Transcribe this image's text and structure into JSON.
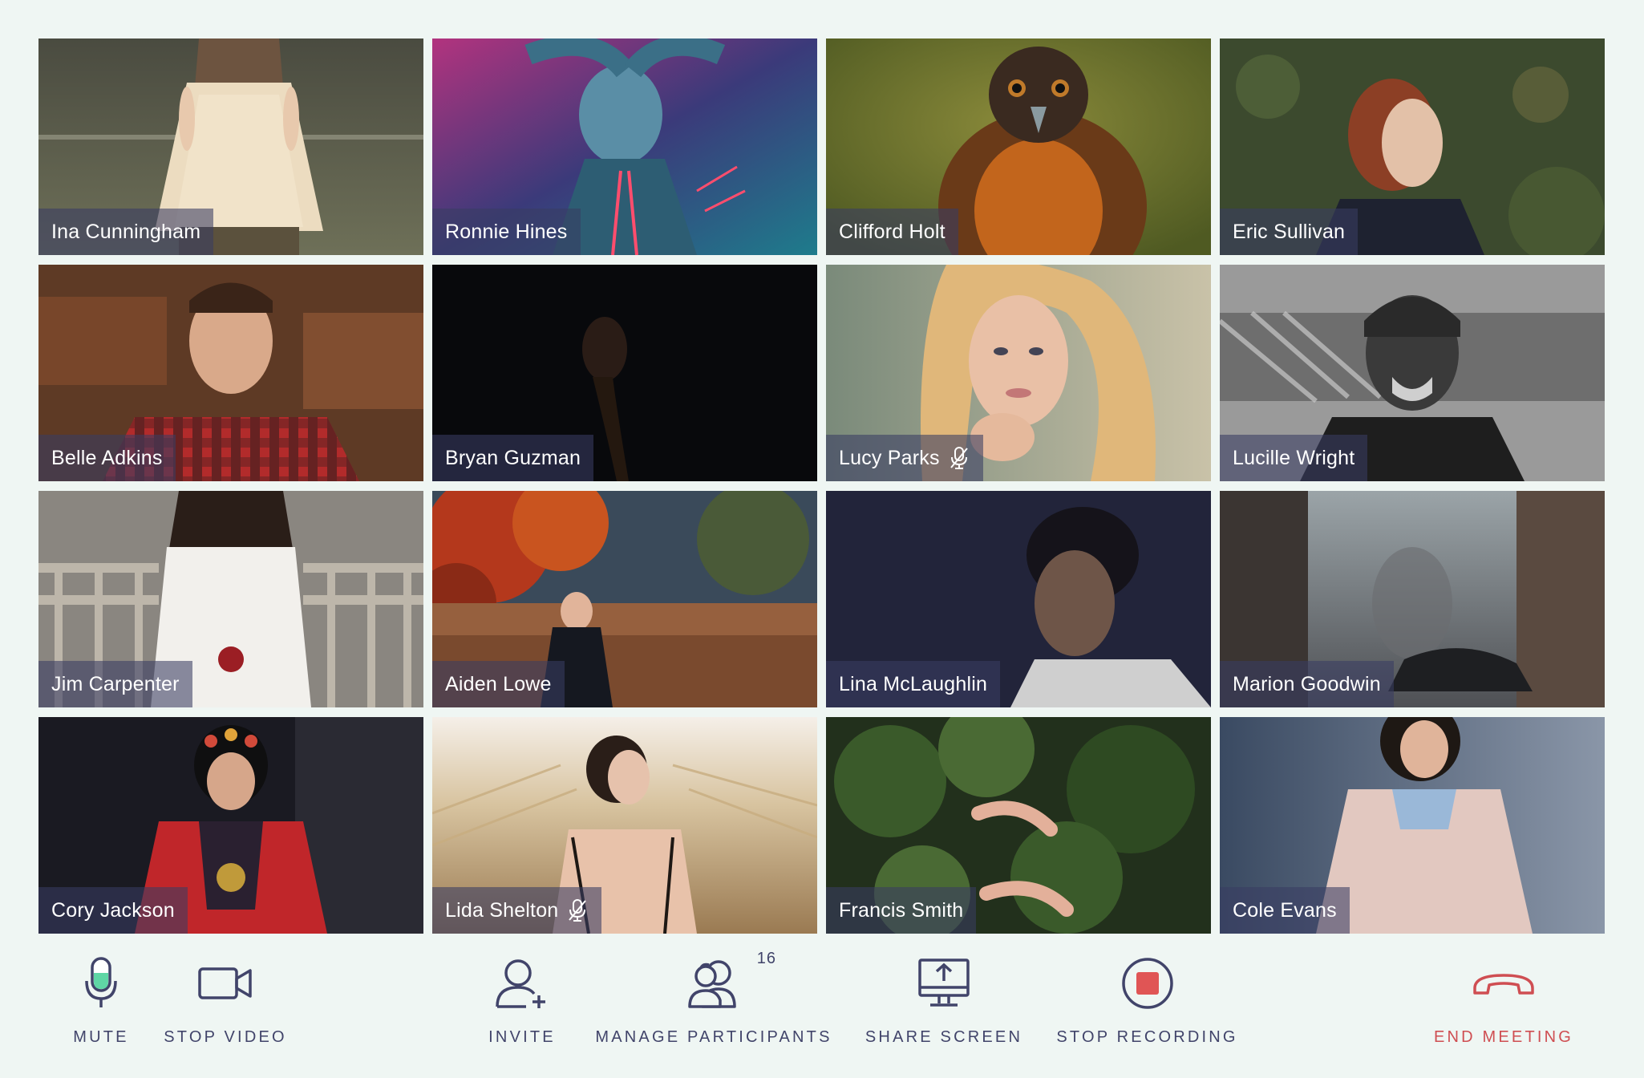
{
  "participants": [
    {
      "name": "Ina Cunningham",
      "muted": false
    },
    {
      "name": "Ronnie Hines",
      "muted": false
    },
    {
      "name": "Clifford Holt",
      "muted": false
    },
    {
      "name": "Eric Sullivan",
      "muted": false
    },
    {
      "name": "Belle Adkins",
      "muted": false
    },
    {
      "name": "Bryan Guzman",
      "muted": false
    },
    {
      "name": "Lucy Parks",
      "muted": true
    },
    {
      "name": "Lucille Wright",
      "muted": false
    },
    {
      "name": "Jim Carpenter",
      "muted": false
    },
    {
      "name": "Aiden Lowe",
      "muted": false
    },
    {
      "name": "Lina McLaughlin",
      "muted": false
    },
    {
      "name": "Marion Goodwin",
      "muted": false
    },
    {
      "name": "Cory Jackson",
      "muted": false
    },
    {
      "name": "Lida Shelton",
      "muted": true
    },
    {
      "name": "Francis Smith",
      "muted": false
    },
    {
      "name": "Cole Evans",
      "muted": false
    }
  ],
  "toolbar": {
    "mute_label": "MUTE",
    "stop_video_label": "STOP VIDEO",
    "invite_label": "INVITE",
    "manage_participants_label": "MANAGE PARTICIPANTS",
    "participant_count": "16",
    "share_screen_label": "SHARE SCREEN",
    "stop_recording_label": "STOP RECORDING",
    "end_meeting_label": "END MEETING"
  },
  "colors": {
    "background": "#eff6f3",
    "icon": "#41446a",
    "mic_active": "#5fd6a5",
    "record": "#e05555",
    "end_meeting": "#cf4e52",
    "nametag_bg": "rgba(56,60,98,0.58)"
  },
  "icons": {
    "mute": "microphone-icon",
    "stop_video": "video-camera-icon",
    "invite": "add-user-icon",
    "manage_participants": "users-icon",
    "share_screen": "share-screen-icon",
    "stop_recording": "record-stop-icon",
    "end_meeting": "hang-up-phone-icon",
    "muted_indicator": "mic-off-icon"
  }
}
